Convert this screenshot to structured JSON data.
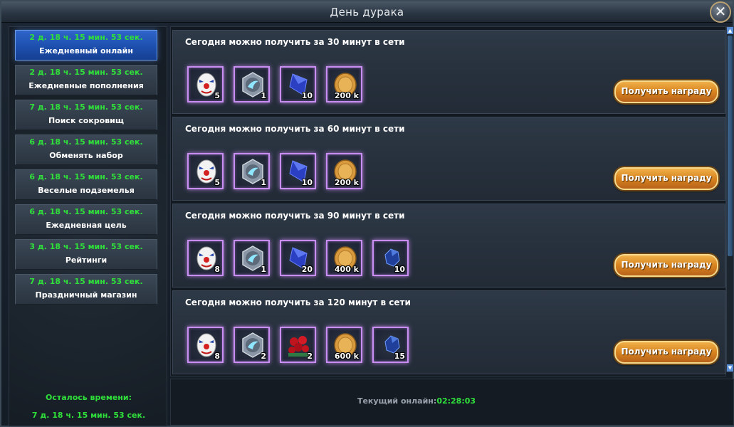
{
  "window": {
    "title": "День дурака",
    "close_label": "✕"
  },
  "sidebar": {
    "items": [
      {
        "timer": "2 д. 18 ч. 15 мин. 53 сек.",
        "label": "Ежедневный онлайн",
        "active": true
      },
      {
        "timer": "2 д. 18 ч. 15 мин. 53 сек.",
        "label": "Ежедневные пополнения"
      },
      {
        "timer": "7 д. 18 ч. 15 мин. 53 сек.",
        "label": "Поиск сокровищ"
      },
      {
        "timer": "6 д. 18 ч. 15 мин. 53 сек.",
        "label": "Обменять набор"
      },
      {
        "timer": "6 д. 18 ч. 15 мин. 53 сек.",
        "label": "Веселые подземелья"
      },
      {
        "timer": "6 д. 18 ч. 15 мин. 53 сек.",
        "label": "Ежедневная цель"
      },
      {
        "timer": "3 д. 18 ч. 15 мин. 53 сек.",
        "label": "Рейтинги"
      },
      {
        "timer": "7 д. 18 ч. 15 мин. 53 сек.",
        "label": "Праздничный магазин"
      }
    ],
    "remaining_label": "Осталось времени:",
    "remaining_value": "7 д. 18 ч. 15 мин. 53 сек."
  },
  "rewards": [
    {
      "title": "Сегодня можно получить за 30 минут в сети",
      "button": "Получить награду",
      "items": [
        {
          "icon": "clown-mask-icon",
          "count": "5"
        },
        {
          "icon": "wing-emblem-icon",
          "count": "1"
        },
        {
          "icon": "blue-crystal-icon",
          "count": "10"
        },
        {
          "icon": "gold-coin-icon",
          "count": "200 k"
        }
      ]
    },
    {
      "title": "Сегодня можно получить за 60 минут в сети",
      "button": "Получить награду",
      "items": [
        {
          "icon": "clown-mask-icon",
          "count": "5"
        },
        {
          "icon": "wing-emblem-icon",
          "count": "1"
        },
        {
          "icon": "blue-crystal-icon",
          "count": "10"
        },
        {
          "icon": "gold-coin-icon",
          "count": "200 k"
        }
      ]
    },
    {
      "title": "Сегодня можно получить за 90 минут в сети",
      "button": "Получить награду",
      "items": [
        {
          "icon": "clown-mask-icon",
          "count": "8"
        },
        {
          "icon": "wing-emblem-icon",
          "count": "1"
        },
        {
          "icon": "blue-crystal-icon",
          "count": "20"
        },
        {
          "icon": "gold-coin-icon",
          "count": "400 k"
        },
        {
          "icon": "blue-ore-icon",
          "count": "10"
        }
      ]
    },
    {
      "title": "Сегодня можно получить за 120 минут в сети",
      "button": "Получить награду",
      "items": [
        {
          "icon": "clown-mask-icon",
          "count": "8"
        },
        {
          "icon": "wing-emblem-icon",
          "count": "2"
        },
        {
          "icon": "red-roses-icon",
          "count": "2"
        },
        {
          "icon": "gold-coin-icon",
          "count": "600 k"
        },
        {
          "icon": "blue-ore-icon",
          "count": "15"
        }
      ]
    }
  ],
  "footer": {
    "online_label": "Текущий онлайн:",
    "online_value": "02:28:03"
  }
}
